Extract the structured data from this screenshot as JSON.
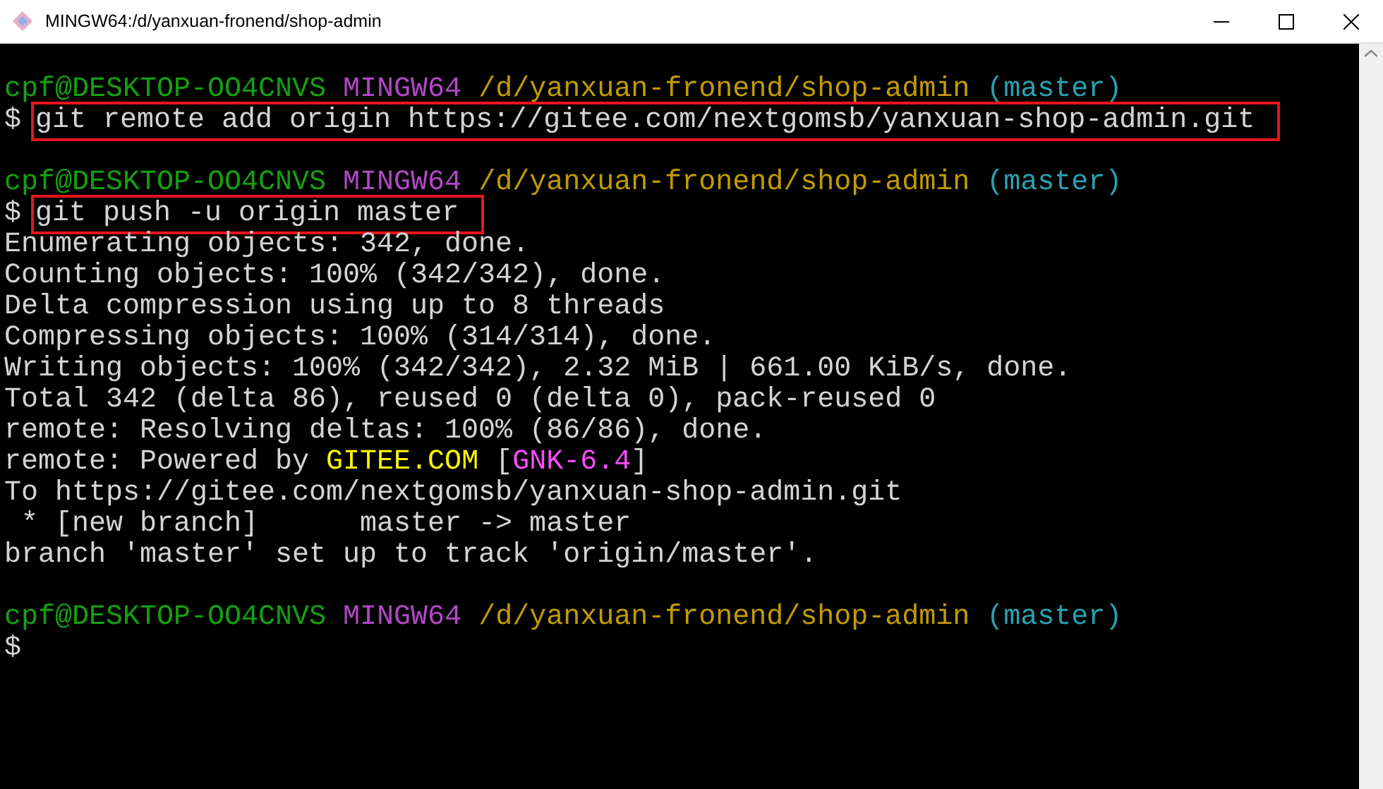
{
  "window": {
    "title": "MINGW64:/d/yanxuan-fronend/shop-admin"
  },
  "lines": [
    {
      "kind": "blank"
    },
    {
      "kind": "prompt",
      "segments": [
        {
          "text": "cpf@DESKTOP-OO4CNVS",
          "color": "#13a10e"
        },
        {
          "text": "MINGW64",
          "color": "#b148c6"
        },
        {
          "text": "/d/yanxuan-fronend/shop-admin",
          "color": "#c19c00"
        },
        {
          "text": "(master)",
          "color": "#2aa1b3"
        }
      ]
    },
    {
      "kind": "command",
      "prompt": "$",
      "text": "git remote add origin https://gitee.com/nextgomsb/yanxuan-shop-admin.git",
      "highlighted": true
    },
    {
      "kind": "blank"
    },
    {
      "kind": "prompt",
      "segments": [
        {
          "text": "cpf@DESKTOP-OO4CNVS",
          "color": "#13a10e"
        },
        {
          "text": "MINGW64",
          "color": "#b148c6"
        },
        {
          "text": "/d/yanxuan-fronend/shop-admin",
          "color": "#c19c00"
        },
        {
          "text": "(master)",
          "color": "#2aa1b3"
        }
      ]
    },
    {
      "kind": "command",
      "prompt": "$",
      "text": "git push -u origin master",
      "highlighted": true
    },
    {
      "kind": "output",
      "segments": [
        {
          "text": "Enumerating objects: 342, done."
        }
      ]
    },
    {
      "kind": "output",
      "segments": [
        {
          "text": "Counting objects: 100% (342/342), done."
        }
      ]
    },
    {
      "kind": "output",
      "segments": [
        {
          "text": "Delta compression using up to 8 threads"
        }
      ]
    },
    {
      "kind": "output",
      "segments": [
        {
          "text": "Compressing objects: 100% (314/314), done."
        }
      ]
    },
    {
      "kind": "output",
      "segments": [
        {
          "text": "Writing objects: 100% (342/342), 2.32 MiB | 661.00 KiB/s, done."
        }
      ]
    },
    {
      "kind": "output",
      "segments": [
        {
          "text": "Total 342 (delta 86), reused 0 (delta 0), pack-reused 0"
        }
      ]
    },
    {
      "kind": "output",
      "segments": [
        {
          "text": "remote: Resolving deltas: 100% (86/86), done."
        }
      ]
    },
    {
      "kind": "output",
      "segments": [
        {
          "text": "remote: Powered by "
        },
        {
          "text": "GITEE.COM",
          "color": "#f9f900"
        },
        {
          "text": " ["
        },
        {
          "text": "GNK-6.4",
          "color": "#f94df9"
        },
        {
          "text": "]"
        }
      ]
    },
    {
      "kind": "output",
      "segments": [
        {
          "text": "To https://gitee.com/nextgomsb/yanxuan-shop-admin.git"
        }
      ]
    },
    {
      "kind": "output",
      "segments": [
        {
          "text": " * [new branch]      master -> master"
        }
      ]
    },
    {
      "kind": "output",
      "segments": [
        {
          "text": "branch 'master' set up to track 'origin/master'."
        }
      ]
    },
    {
      "kind": "blank"
    },
    {
      "kind": "prompt",
      "segments": [
        {
          "text": "cpf@DESKTOP-OO4CNVS",
          "color": "#13a10e"
        },
        {
          "text": "MINGW64",
          "color": "#b148c6"
        },
        {
          "text": "/d/yanxuan-fronend/shop-admin",
          "color": "#c19c00"
        },
        {
          "text": "(master)",
          "color": "#2aa1b3"
        }
      ]
    },
    {
      "kind": "cursor",
      "prompt": "$"
    }
  ]
}
